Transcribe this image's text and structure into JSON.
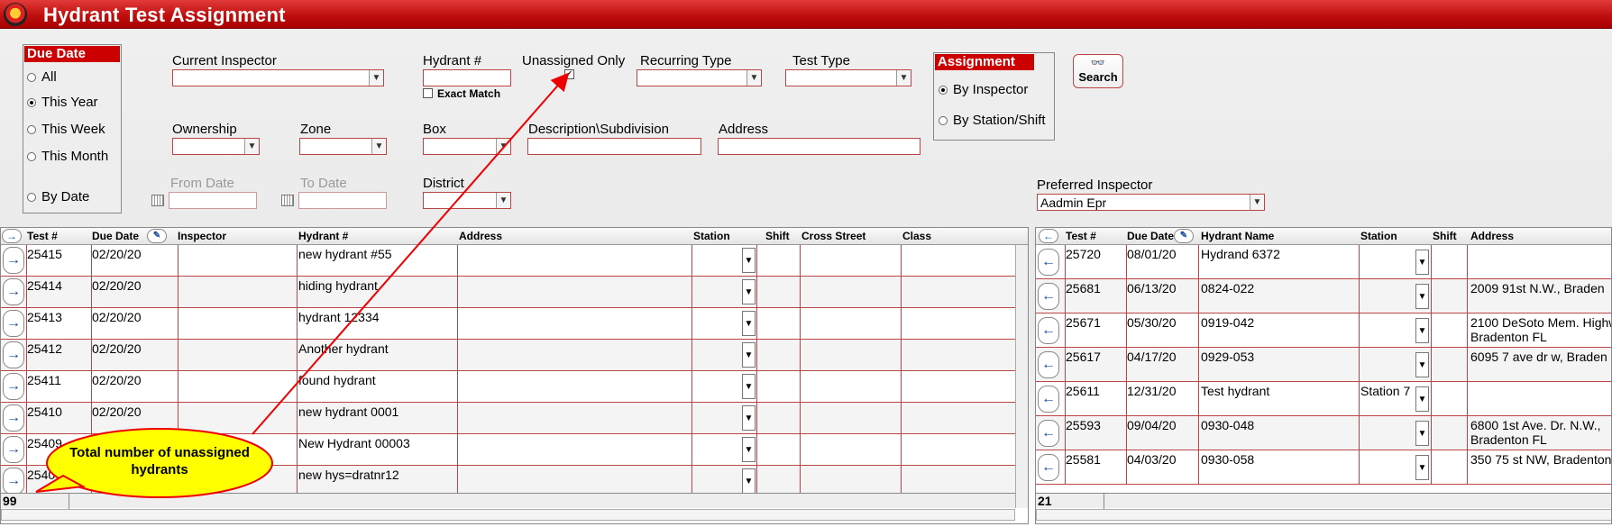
{
  "window": {
    "title": "Hydrant Test Assignment"
  },
  "filters": {
    "due_date": {
      "heading": "Due Date",
      "options": [
        "All",
        "This Year",
        "This Week",
        "This Month",
        "By Date"
      ],
      "selected": "This Year"
    },
    "current_inspector": {
      "label": "Current Inspector",
      "value": ""
    },
    "hydrant_number": {
      "label": "Hydrant #",
      "value": ""
    },
    "exact_match": {
      "label": "Exact Match",
      "checked": false
    },
    "unassigned_only": {
      "label": "Unassigned Only",
      "checked": true
    },
    "recurring_type": {
      "label": "Recurring Type",
      "value": ""
    },
    "test_type": {
      "label": "Test Type",
      "value": ""
    },
    "ownership": {
      "label": "Ownership",
      "value": ""
    },
    "zone": {
      "label": "Zone",
      "value": ""
    },
    "box": {
      "label": "Box",
      "value": ""
    },
    "description": {
      "label": "Description\\Subdivision",
      "value": ""
    },
    "address": {
      "label": "Address",
      "value": ""
    },
    "from_date": {
      "label": "From Date",
      "value": ""
    },
    "to_date": {
      "label": "To Date",
      "value": ""
    },
    "district": {
      "label": "District",
      "value": ""
    },
    "assignment": {
      "heading": "Assignment",
      "options": [
        "By Inspector",
        "By Station/Shift"
      ],
      "selected": "By Inspector"
    },
    "search_label": "Search",
    "preferred_inspector": {
      "label": "Preferred Inspector",
      "value": "Aadmin Epr"
    }
  },
  "left_grid": {
    "headers": [
      "Test #",
      "Due Date",
      "Inspector",
      "Hydrant #",
      "Address",
      "Station",
      "Shift",
      "Cross Street",
      "Class"
    ],
    "rows": [
      {
        "test": "25415",
        "due": "02/20/20",
        "inspector": "",
        "hydrant": "new hydrant #55"
      },
      {
        "test": "25414",
        "due": "02/20/20",
        "inspector": "",
        "hydrant": "hiding hydrant"
      },
      {
        "test": "25413",
        "due": "02/20/20",
        "inspector": "",
        "hydrant": "hydrant 12334"
      },
      {
        "test": "25412",
        "due": "02/20/20",
        "inspector": "",
        "hydrant": "Another hydrant"
      },
      {
        "test": "25411",
        "due": "02/20/20",
        "inspector": "",
        "hydrant": "found hydrant"
      },
      {
        "test": "25410",
        "due": "02/20/20",
        "inspector": "",
        "hydrant": "new hydrant 0001"
      },
      {
        "test": "25409",
        "due": "",
        "inspector": "",
        "hydrant": "New Hydrant 00003"
      },
      {
        "test": "2540",
        "due": "",
        "inspector": "",
        "hydrant": "new hys=dratnr12"
      }
    ],
    "total": "99"
  },
  "right_grid": {
    "headers": [
      "Test #",
      "Due Date",
      "Hydrant Name",
      "Station",
      "Shift",
      "Address"
    ],
    "rows": [
      {
        "test": "25720",
        "due": "08/01/20",
        "name": "Hydrand 6372",
        "station": "",
        "addr1": "",
        "addr2": ""
      },
      {
        "test": "25681",
        "due": "06/13/20",
        "name": "0824-022",
        "station": "",
        "addr1": "2009 91st  N.W., Braden",
        "addr2": ""
      },
      {
        "test": "25671",
        "due": "05/30/20",
        "name": "0919-042",
        "station": "",
        "addr1": "2100 DeSoto Mem. Highw",
        "addr2": "Bradenton FL"
      },
      {
        "test": "25617",
        "due": "04/17/20",
        "name": "0929-053",
        "station": "",
        "addr1": "6095 7 ave dr w, Braden",
        "addr2": ""
      },
      {
        "test": "25611",
        "due": "12/31/20",
        "name": "Test hydrant",
        "station": "Station 7",
        "addr1": "",
        "addr2": ""
      },
      {
        "test": "25593",
        "due": "09/04/20",
        "name": "0930-048",
        "station": "",
        "addr1": "6800 1st Ave. Dr. N.W.,",
        "addr2": "Bradenton FL"
      },
      {
        "test": "25581",
        "due": "04/03/20",
        "name": "0930-058",
        "station": "",
        "addr1": "350 75 st NW, Bradenton",
        "addr2": ""
      }
    ],
    "total": "21"
  },
  "annotation": {
    "text": "Total number of unassigned hydrants"
  },
  "colors": {
    "accent": "#c00000",
    "border": "#bb4444",
    "callout": "#ffff00",
    "nav_icon": "#1a4fa0"
  }
}
